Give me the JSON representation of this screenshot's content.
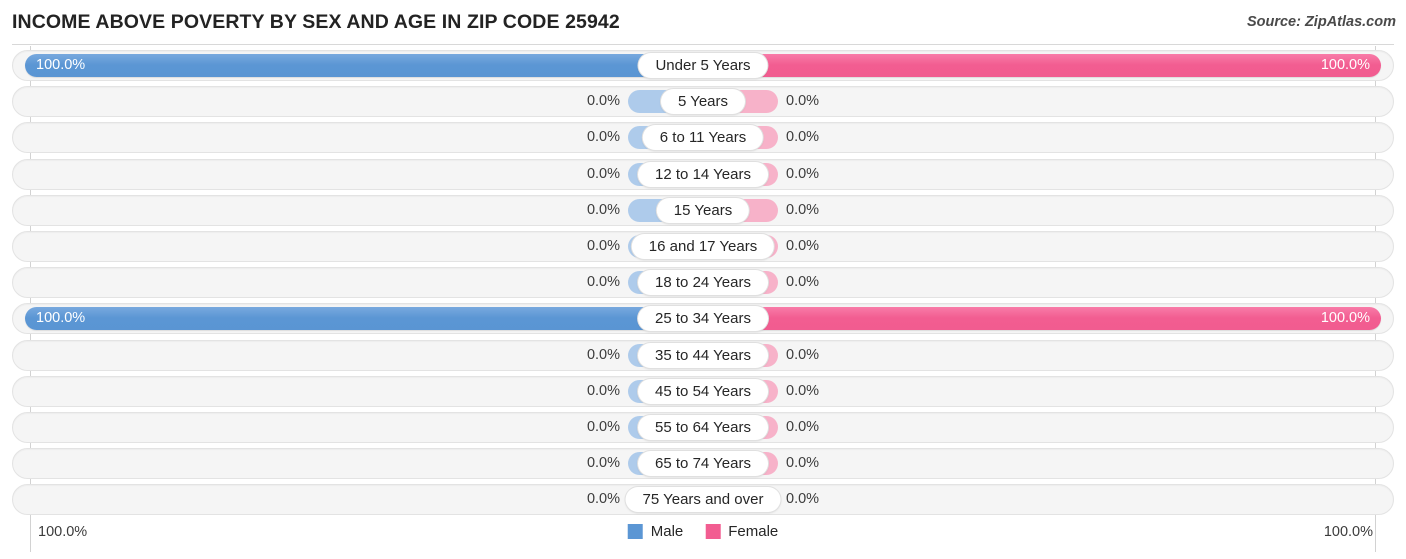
{
  "header": {
    "title": "INCOME ABOVE POVERTY BY SEX AND AGE IN ZIP CODE 25942",
    "source": "Source: ZipAtlas.com"
  },
  "legend": {
    "male": {
      "label": "Male",
      "color": "#5b96d4"
    },
    "female": {
      "label": "Female",
      "color": "#f25d91"
    }
  },
  "axis": {
    "left_label": "100.0%",
    "right_label": "100.0%"
  },
  "colors": {
    "male_bar": "#5b96d4",
    "female_bar": "#f25d91",
    "male_zero_bar": "#aecbeb",
    "female_zero_bar": "#f7b2c9",
    "track": "#f5f5f5",
    "gridline": "#d2d2d2"
  },
  "chart_data": {
    "type": "bar",
    "title": "INCOME ABOVE POVERTY BY SEX AND AGE IN ZIP CODE 25942",
    "subtitle": "",
    "xlabel": "",
    "ylabel": "",
    "orientation": "horizontal",
    "style": "diverging-bidirectional",
    "xlim": [
      0,
      100
    ],
    "grid": true,
    "legend_position": "bottom-center",
    "categories": [
      "Under 5 Years",
      "5 Years",
      "6 to 11 Years",
      "12 to 14 Years",
      "15 Years",
      "16 and 17 Years",
      "18 to 24 Years",
      "25 to 34 Years",
      "35 to 44 Years",
      "45 to 54 Years",
      "55 to 64 Years",
      "65 to 74 Years",
      "75 Years and over"
    ],
    "series": [
      {
        "name": "Male",
        "side": "left",
        "values": [
          100.0,
          0.0,
          0.0,
          0.0,
          0.0,
          0.0,
          0.0,
          100.0,
          0.0,
          0.0,
          0.0,
          0.0,
          0.0
        ]
      },
      {
        "name": "Female",
        "side": "right",
        "values": [
          100.0,
          0.0,
          0.0,
          0.0,
          0.0,
          0.0,
          0.0,
          100.0,
          0.0,
          0.0,
          0.0,
          0.0,
          0.0
        ]
      }
    ]
  },
  "rows": [
    {
      "label": "Under 5 Years",
      "male": "100.0%",
      "female": "100.0%",
      "male_zero": false,
      "female_zero": false
    },
    {
      "label": "5 Years",
      "male": "0.0%",
      "female": "0.0%",
      "male_zero": true,
      "female_zero": true
    },
    {
      "label": "6 to 11 Years",
      "male": "0.0%",
      "female": "0.0%",
      "male_zero": true,
      "female_zero": true
    },
    {
      "label": "12 to 14 Years",
      "male": "0.0%",
      "female": "0.0%",
      "male_zero": true,
      "female_zero": true
    },
    {
      "label": "15 Years",
      "male": "0.0%",
      "female": "0.0%",
      "male_zero": true,
      "female_zero": true
    },
    {
      "label": "16 and 17 Years",
      "male": "0.0%",
      "female": "0.0%",
      "male_zero": true,
      "female_zero": true
    },
    {
      "label": "18 to 24 Years",
      "male": "0.0%",
      "female": "0.0%",
      "male_zero": true,
      "female_zero": true
    },
    {
      "label": "25 to 34 Years",
      "male": "100.0%",
      "female": "100.0%",
      "male_zero": false,
      "female_zero": false
    },
    {
      "label": "35 to 44 Years",
      "male": "0.0%",
      "female": "0.0%",
      "male_zero": true,
      "female_zero": true
    },
    {
      "label": "45 to 54 Years",
      "male": "0.0%",
      "female": "0.0%",
      "male_zero": true,
      "female_zero": true
    },
    {
      "label": "55 to 64 Years",
      "male": "0.0%",
      "female": "0.0%",
      "male_zero": true,
      "female_zero": true
    },
    {
      "label": "65 to 74 Years",
      "male": "0.0%",
      "female": "0.0%",
      "male_zero": true,
      "female_zero": true
    },
    {
      "label": "75 Years and over",
      "male": "0.0%",
      "female": "0.0%",
      "male_zero": true,
      "female_zero": true
    }
  ]
}
